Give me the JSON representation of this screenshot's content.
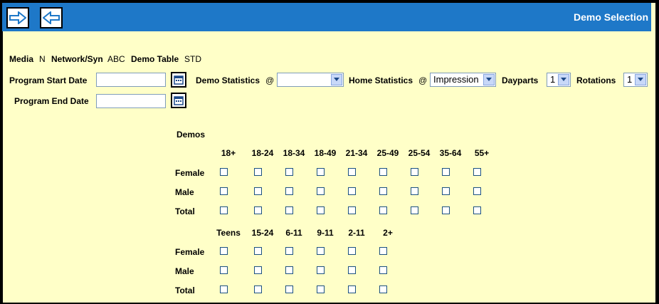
{
  "header": {
    "title": "Demo Selection"
  },
  "toolbar": {
    "forward_icon": "arrow-right-icon",
    "back_icon": "arrow-left-icon"
  },
  "info": {
    "media_label": "Media",
    "media_value": "N",
    "network_label": "Network/Syn",
    "network_value": "ABC",
    "demo_table_label": "Demo Table",
    "demo_table_value": "STD"
  },
  "form": {
    "start_date_label": "Program Start Date",
    "end_date_label": "Program End Date",
    "start_date_value": "",
    "end_date_value": "",
    "demo_stats_label": "Demo Statistics",
    "demo_stats_at": "@",
    "demo_stats_value": "",
    "home_stats_label": "Home Statistics",
    "home_stats_at": "@",
    "home_stats_value": "Impression",
    "dayparts_label": "Dayparts",
    "dayparts_value": "1",
    "rotations_label": "Rotations",
    "rotations_value": "1"
  },
  "demos": {
    "title": "Demos",
    "adult_columns": [
      "18+",
      "18-24",
      "18-34",
      "18-49",
      "21-34",
      "25-49",
      "25-54",
      "35-64",
      "55+"
    ],
    "teen_columns": [
      "Teens",
      "15-24",
      "6-11",
      "9-11",
      "2-11",
      "2+"
    ],
    "rows": [
      "Female",
      "Male",
      "Total"
    ]
  },
  "colors": {
    "background": "#ffffc8",
    "header_bar": "#1e78c8",
    "header_text": "#ffffff"
  }
}
